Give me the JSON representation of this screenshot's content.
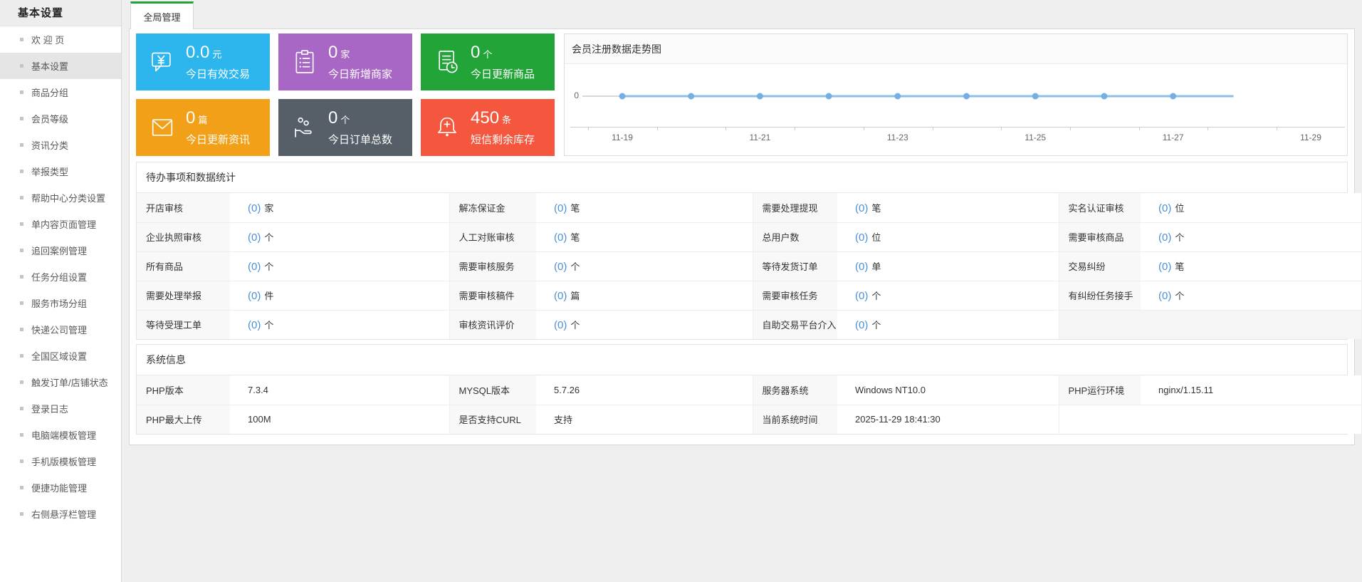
{
  "sidebar": {
    "header": "基本设置",
    "items": [
      {
        "label": "欢 迎 页",
        "active": false
      },
      {
        "label": "基本设置",
        "active": true
      },
      {
        "label": "商品分组",
        "active": false
      },
      {
        "label": "会员等级",
        "active": false
      },
      {
        "label": "资讯分类",
        "active": false
      },
      {
        "label": "举报类型",
        "active": false
      },
      {
        "label": "帮助中心分类设置",
        "active": false
      },
      {
        "label": "单内容页面管理",
        "active": false
      },
      {
        "label": "追回案例管理",
        "active": false
      },
      {
        "label": "任务分组设置",
        "active": false
      },
      {
        "label": "服务市场分组",
        "active": false
      },
      {
        "label": "快递公司管理",
        "active": false
      },
      {
        "label": "全国区域设置",
        "active": false
      },
      {
        "label": "触发订单/店铺状态",
        "active": false
      },
      {
        "label": "登录日志",
        "active": false
      },
      {
        "label": "电脑端模板管理",
        "active": false
      },
      {
        "label": "手机版模板管理",
        "active": false
      },
      {
        "label": "便捷功能管理",
        "active": false
      },
      {
        "label": "右侧悬浮栏管理",
        "active": false
      }
    ]
  },
  "tab": {
    "label": "全局管理"
  },
  "cards": [
    {
      "icon": "currency-bubble-icon",
      "color": "#2cb6ed",
      "value": "0.0",
      "unit": "元",
      "label": "今日有效交易"
    },
    {
      "icon": "clipboard-list-icon",
      "color": "#a866c5",
      "value": "0",
      "unit": "家",
      "label": "今日新增商家"
    },
    {
      "icon": "doc-clock-icon",
      "color": "#23a439",
      "value": "0",
      "unit": "个",
      "label": "今日更新商品"
    },
    {
      "icon": "envelope-icon",
      "color": "#f2a018",
      "value": "0",
      "unit": "篇",
      "label": "今日更新资讯"
    },
    {
      "icon": "hand-coins-icon",
      "color": "#565e67",
      "value": "0",
      "unit": "个",
      "label": "今日订单总数"
    },
    {
      "icon": "bell-plus-icon",
      "color": "#f4573d",
      "value": "450",
      "unit": "条",
      "label": "短信剩余库存"
    }
  ],
  "chart_data": {
    "type": "line",
    "title": "会员注册数据走势图",
    "x": [
      "11-19",
      "11-20",
      "11-21",
      "11-22",
      "11-23",
      "11-24",
      "11-25",
      "11-26",
      "11-27"
    ],
    "values": [
      0,
      0,
      0,
      0,
      0,
      0,
      0,
      0,
      0
    ],
    "x_tick_labels": [
      "11-19",
      "11-21",
      "11-23",
      "11-25",
      "11-27",
      "11-29"
    ],
    "y_tick_labels": [
      "0"
    ],
    "ylabel": "",
    "xlabel": "",
    "grid": false,
    "legend": false,
    "line_color": "#8bbfe9",
    "marker_color": "#74afe3"
  },
  "todo": {
    "title": "待办事项和数据统计",
    "rows": [
      [
        {
          "label": "开店审核",
          "count": "(0)",
          "unit": "家"
        },
        {
          "label": "解冻保证金",
          "count": "(0)",
          "unit": "笔"
        },
        {
          "label": "需要处理提现",
          "count": "(0)",
          "unit": "笔"
        },
        {
          "label": "实名认证审核",
          "count": "(0)",
          "unit": "位"
        }
      ],
      [
        {
          "label": "企业执照审核",
          "count": "(0)",
          "unit": "个"
        },
        {
          "label": "人工对账审核",
          "count": "(0)",
          "unit": "笔"
        },
        {
          "label": "总用户数",
          "count": "(0)",
          "unit": "位"
        },
        {
          "label": "需要审核商品",
          "count": "(0)",
          "unit": "个"
        }
      ],
      [
        {
          "label": "所有商品",
          "count": "(0)",
          "unit": "个"
        },
        {
          "label": "需要审核服务",
          "count": "(0)",
          "unit": "个"
        },
        {
          "label": "等待发货订单",
          "count": "(0)",
          "unit": "单"
        },
        {
          "label": "交易纠纷",
          "count": "(0)",
          "unit": "笔"
        }
      ],
      [
        {
          "label": "需要处理举报",
          "count": "(0)",
          "unit": "件"
        },
        {
          "label": "需要审核稿件",
          "count": "(0)",
          "unit": "篇"
        },
        {
          "label": "需要审核任务",
          "count": "(0)",
          "unit": "个"
        },
        {
          "label": "有纠纷任务接手",
          "count": "(0)",
          "unit": "个"
        }
      ],
      [
        {
          "label": "等待受理工单",
          "count": "(0)",
          "unit": "个"
        },
        {
          "label": "审核资讯评价",
          "count": "(0)",
          "unit": "个"
        },
        {
          "label": "自助交易平台介入",
          "count": "(0)",
          "unit": "个"
        },
        null
      ]
    ]
  },
  "system": {
    "title": "系统信息",
    "rows": [
      [
        {
          "label": "PHP版本",
          "value": "7.3.4"
        },
        {
          "label": "MYSQL版本",
          "value": "5.7.26"
        },
        {
          "label": "服务器系统",
          "value": "Windows NT10.0"
        },
        {
          "label": "PHP运行环境",
          "value": "nginx/1.15.11"
        }
      ],
      [
        {
          "label": "PHP最大上传",
          "value": "100M"
        },
        {
          "label": "是否支持CURL",
          "value": "支持"
        },
        {
          "label": "当前系统时间",
          "value": "2025-11-29 18:41:30"
        },
        null
      ]
    ]
  }
}
